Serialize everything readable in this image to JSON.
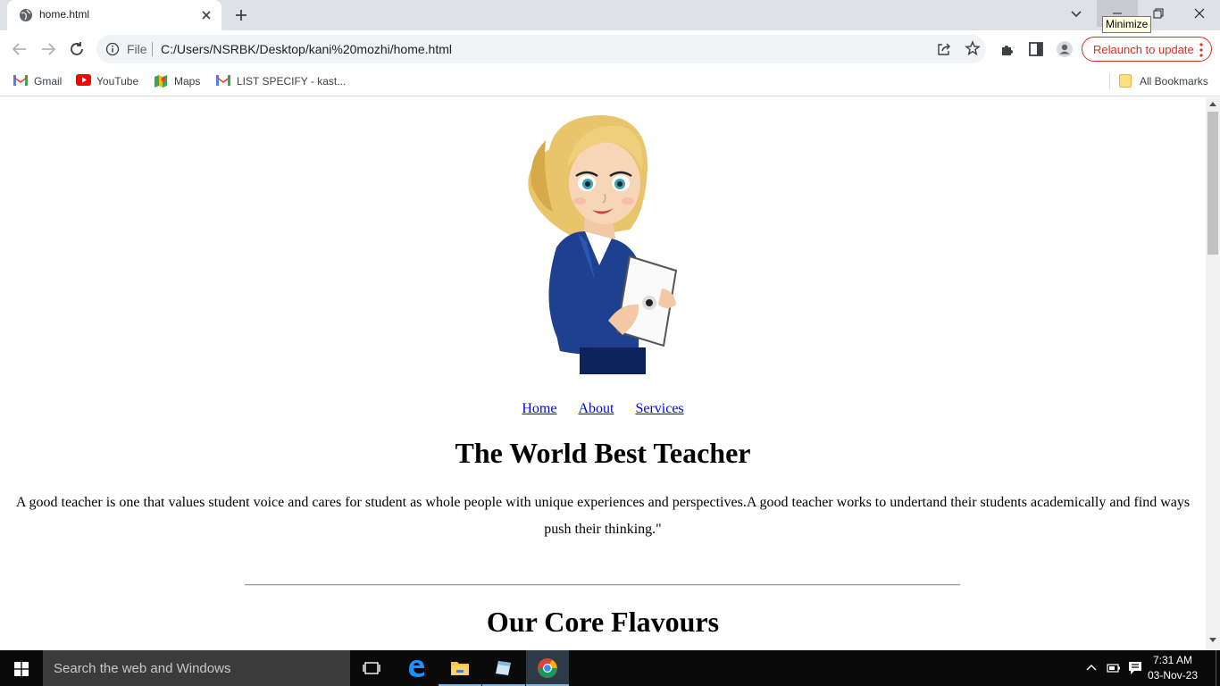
{
  "browser": {
    "tab": {
      "title": "home.html",
      "favicon": "globe-icon"
    },
    "tooltip": "Minimize",
    "address": {
      "scheme_label": "File",
      "url": "C:/Users/NSRBK/Desktop/kani%20mozhi/home.html"
    },
    "relaunch_label": "Relaunch to update",
    "accent_color": "#d93025"
  },
  "bookmarks": {
    "items": [
      {
        "label": "Gmail",
        "icon": "gmail-icon"
      },
      {
        "label": "YouTube",
        "icon": "youtube-icon"
      },
      {
        "label": "Maps",
        "icon": "maps-icon"
      },
      {
        "label": "LIST SPECIFY - kast...",
        "icon": "gmail-icon"
      }
    ],
    "all_bookmarks": "All Bookmarks"
  },
  "page": {
    "nav": [
      "Home",
      "About",
      "Services"
    ],
    "title": "The World Best Teacher",
    "intro": "A good teacher is one that values student voice and cares for student as whole people with unique experiences and perspectives.A good teacher works to undertand their students academically and find ways push their thinking.\"",
    "section_title": "Our Core Flavours",
    "link_color": "#0000ee"
  },
  "taskbar": {
    "search_placeholder": "Search the web and Windows",
    "time": "7:31 AM",
    "date": "03-Nov-23"
  }
}
